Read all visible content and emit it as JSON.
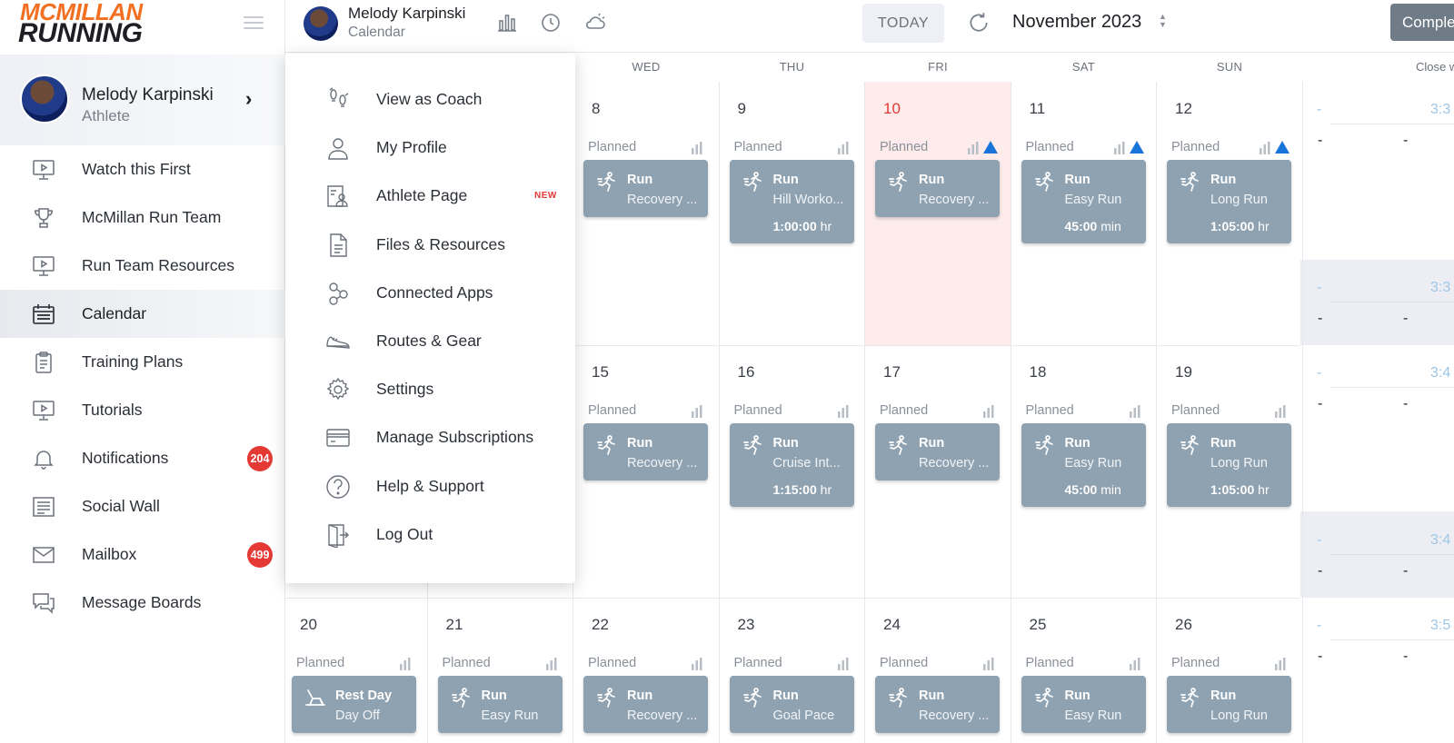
{
  "brand": {
    "line1": "MCMILLAN",
    "line2": "RUNNING",
    "accent": "#f36f21"
  },
  "profile": {
    "name": "Melody Karpinski",
    "role": "Athlete"
  },
  "nav": [
    {
      "label": "Watch this First",
      "icon": "monitor-play-icon"
    },
    {
      "label": "McMillan Run Team",
      "icon": "trophy-icon"
    },
    {
      "label": "Run Team Resources",
      "icon": "monitor-play-icon"
    },
    {
      "label": "Calendar",
      "icon": "calendar-icon",
      "active": true
    },
    {
      "label": "Training Plans",
      "icon": "clipboard-icon"
    },
    {
      "label": "Tutorials",
      "icon": "monitor-play-icon"
    },
    {
      "label": "Notifications",
      "icon": "bell-icon",
      "badge": "204"
    },
    {
      "label": "Social Wall",
      "icon": "newspaper-icon"
    },
    {
      "label": "Mailbox",
      "icon": "mail-icon",
      "badge": "499"
    },
    {
      "label": "Message Boards",
      "icon": "chat-icon"
    }
  ],
  "header": {
    "name": "Melody Karpinski",
    "subtitle": "Calendar",
    "today_label": "TODAY",
    "month_label": "November 2023",
    "complete_label": "Complete"
  },
  "menu": [
    {
      "label": "View as Coach",
      "icon": "footsteps-icon"
    },
    {
      "label": "My Profile",
      "icon": "user-icon"
    },
    {
      "label": "Athlete Page",
      "icon": "id-card-icon",
      "tag": "NEW"
    },
    {
      "label": "Files & Resources",
      "icon": "file-icon"
    },
    {
      "label": "Connected Apps",
      "icon": "nodes-icon"
    },
    {
      "label": "Routes & Gear",
      "icon": "shoe-icon"
    },
    {
      "label": "Settings",
      "icon": "gear-icon"
    },
    {
      "label": "Manage Subscriptions",
      "icon": "credit-card-icon"
    },
    {
      "label": "Help & Support",
      "icon": "help-icon"
    },
    {
      "label": "Log Out",
      "icon": "logout-icon"
    }
  ],
  "calendar": {
    "weekdays": [
      "WED",
      "THU",
      "FRI",
      "SAT",
      "SUN"
    ],
    "close_label": "Close w",
    "planned_label": "Planned",
    "weeks": [
      {
        "days": [
          {
            "num": "8",
            "type": "Run",
            "name": "Recovery ...",
            "dur": "",
            "unit": ""
          },
          {
            "num": "9",
            "type": "Run",
            "name": "Hill Worko...",
            "dur": "1:00:00",
            "unit": "hr"
          },
          {
            "num": "10",
            "type": "Run",
            "name": "Recovery ...",
            "dur": "",
            "unit": "",
            "today": true,
            "alert": true
          },
          {
            "num": "11",
            "type": "Run",
            "name": "Easy Run",
            "dur": "45:00",
            "unit": "min",
            "alert": true
          },
          {
            "num": "12",
            "type": "Run",
            "name": "Long Run",
            "dur": "1:05:00",
            "unit": "hr",
            "alert": true
          }
        ],
        "summary_time": "3:3"
      },
      {
        "days": [
          {
            "num": "15",
            "type": "Run",
            "name": "Recovery ...",
            "dur": "",
            "unit": ""
          },
          {
            "num": "16",
            "type": "Run",
            "name": "Cruise Int...",
            "dur": "1:15:00",
            "unit": "hr"
          },
          {
            "num": "17",
            "type": "Run",
            "name": "Recovery ...",
            "dur": "",
            "unit": ""
          },
          {
            "num": "18",
            "type": "Run",
            "name": "Easy Run",
            "dur": "45:00",
            "unit": "min"
          },
          {
            "num": "19",
            "type": "Run",
            "name": "Long Run",
            "dur": "1:05:00",
            "unit": "hr"
          }
        ],
        "summary_time": "3:4"
      },
      {
        "days": [
          {
            "num": "20",
            "type": "Rest Day",
            "name": "Day Off",
            "dur": "",
            "unit": "",
            "rest": true
          },
          {
            "num": "21",
            "type": "Run",
            "name": "Easy Run",
            "dur": "",
            "unit": ""
          },
          {
            "num": "22",
            "type": "Run",
            "name": "Recovery ...",
            "dur": "",
            "unit": ""
          },
          {
            "num": "23",
            "type": "Run",
            "name": "Goal Pace",
            "dur": "",
            "unit": ""
          },
          {
            "num": "24",
            "type": "Run",
            "name": "Recovery ...",
            "dur": "",
            "unit": ""
          },
          {
            "num": "25",
            "type": "Run",
            "name": "Easy Run",
            "dur": "",
            "unit": ""
          },
          {
            "num": "26",
            "type": "Run",
            "name": "Long Run",
            "dur": "",
            "unit": ""
          }
        ],
        "summary_time": "3:5"
      }
    ],
    "summary_dash": "-",
    "colors": {
      "card": "#8fa2b1",
      "today_bg": "#fdeceb",
      "alert": "#1a73d9",
      "badge": "#e53935"
    }
  }
}
